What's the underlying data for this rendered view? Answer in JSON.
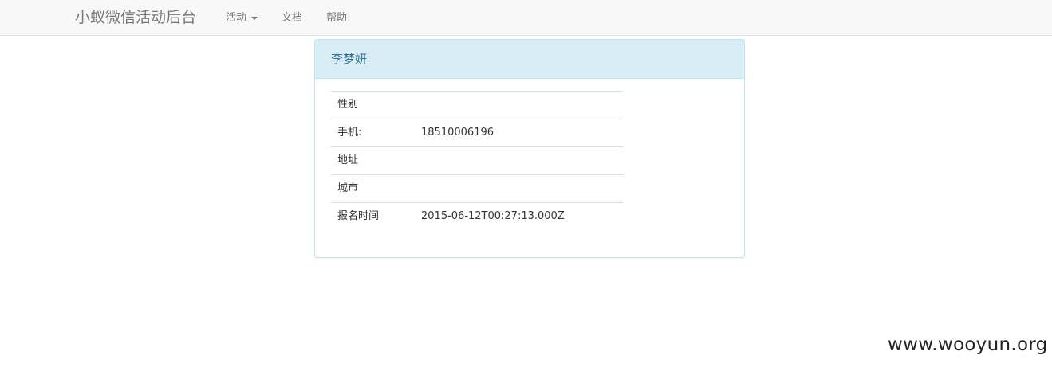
{
  "navbar": {
    "brand": "小蚁微信活动后台",
    "items": [
      {
        "label": "活动",
        "dropdown": true
      },
      {
        "label": "文档"
      },
      {
        "label": "帮助"
      }
    ]
  },
  "panel": {
    "title": "李梦妍",
    "rows": [
      {
        "label": "性别",
        "value": ""
      },
      {
        "label": "手机:",
        "value": "18510006196"
      },
      {
        "label": "地址",
        "value": ""
      },
      {
        "label": "城市",
        "value": ""
      },
      {
        "label": "报名时间",
        "value": "2015-06-12T00:27:13.000Z"
      }
    ]
  },
  "watermark": "www.wooyun.org",
  "colors": {
    "navbar_bg": "#f8f8f8",
    "panel_heading_bg": "#d9edf7",
    "panel_border": "#bce8f1",
    "panel_title": "#31708f"
  }
}
